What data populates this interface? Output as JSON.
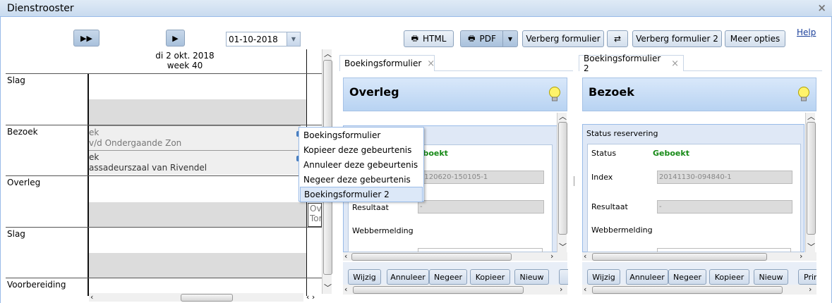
{
  "window": {
    "title": "Dienstrooster"
  },
  "toolbar_left": {
    "date_value": "01-10-2018"
  },
  "toolbar_right": {
    "html_label": "HTML",
    "pdf_label": "PDF",
    "hide_form_label": "Verberg formulier",
    "swap_label": "⇄",
    "hide_form2_label": "Verberg formulier 2",
    "more_label": "Meer opties",
    "help_label": "Help"
  },
  "calendar": {
    "day_label": "di 2 okt. 2018",
    "week_label": "week 40",
    "rows": [
      "Slag",
      "Bezoek",
      "Overleg",
      "Slag",
      "Voorbereiding"
    ],
    "events": [
      {
        "line1": "ek",
        "line2": "v/d Ondergaande Zon"
      },
      {
        "line1": "ek",
        "line2": "assadeurszaal van Rivendel"
      }
    ],
    "overleg_block": {
      "line1": "Ov",
      "line2": "Tor"
    }
  },
  "context_menu": {
    "items": [
      "Boekingsformulier",
      "Kopieer deze gebeurtenis",
      "Annuleer deze gebeurtenis",
      "Negeer deze gebeurtenis",
      "Boekingsformulier 2"
    ],
    "selected_index": 4
  },
  "form1": {
    "tab_label": "Boekingsformulier",
    "heading": "Overleg",
    "status_value": "eboekt",
    "index_value": "0120620-150105-1",
    "resultaat_label": "Resultaat",
    "resultaat_value": "-",
    "webbermelding_label": "Webbermelding",
    "buttons": [
      "Wijzig",
      "Annuleer",
      "Negeer",
      "Kopieer",
      "Nieuw"
    ]
  },
  "form2": {
    "tab_label": "Boekingsformulier 2",
    "heading": "Bezoek",
    "section_title": "Status reservering",
    "status_label": "Status",
    "status_value": "Geboekt",
    "index_label": "Index",
    "index_value": "20141130-094840-1",
    "resultaat_label": "Resultaat",
    "resultaat_value": "-",
    "webbermelding_label": "Webbermelding",
    "buttons": [
      "Wijzig",
      "Annuleer",
      "Negeer",
      "Kopieer",
      "Nieuw",
      "Prin"
    ]
  },
  "colors": {
    "accent": "#99bbe8",
    "status_green": "#178a17",
    "link": "#1a3f9a"
  }
}
